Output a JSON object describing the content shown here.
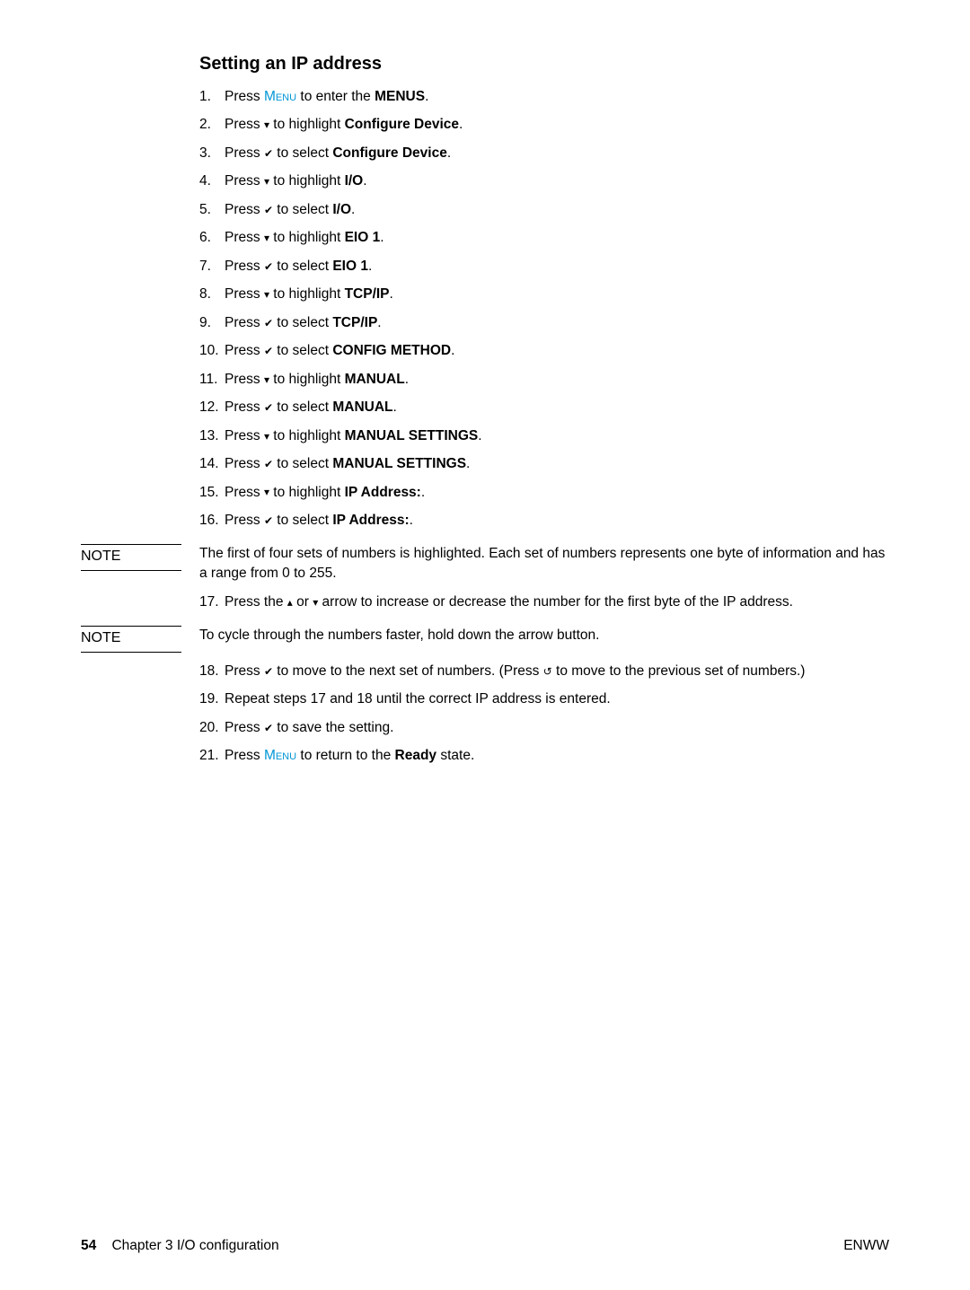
{
  "heading": "Setting an IP address",
  "menu_word": "Menu",
  "icons": {
    "down": "▾",
    "up": "▴",
    "check": "✔",
    "back": "↺"
  },
  "steps1": [
    {
      "n": "1.",
      "pre": "Press ",
      "menu": true,
      "mid": " to enter the ",
      "bold": "MENUS",
      "post": "."
    },
    {
      "n": "2.",
      "pre": "Press ",
      "icon": "down",
      "mid": " to highlight ",
      "bold": "Configure Device",
      "post": "."
    },
    {
      "n": "3.",
      "pre": "Press ",
      "icon": "check",
      "mid": " to select ",
      "bold": "Configure Device",
      "post": "."
    },
    {
      "n": "4.",
      "pre": "Press ",
      "icon": "down",
      "mid": " to highlight ",
      "bold": "I/O",
      "post": "."
    },
    {
      "n": "5.",
      "pre": "Press ",
      "icon": "check",
      "mid": " to select ",
      "bold": "I/O",
      "post": "."
    },
    {
      "n": "6.",
      "pre": "Press ",
      "icon": "down",
      "mid": " to highlight ",
      "bold": "EIO 1",
      "post": "."
    },
    {
      "n": "7.",
      "pre": "Press ",
      "icon": "check",
      "mid": " to select ",
      "bold": "EIO 1",
      "post": "."
    },
    {
      "n": "8.",
      "pre": "Press ",
      "icon": "down",
      "mid": " to highlight ",
      "bold": "TCP/IP",
      "post": "."
    },
    {
      "n": "9.",
      "pre": "Press ",
      "icon": "check",
      "mid": " to select ",
      "bold": "TCP/IP",
      "post": "."
    },
    {
      "n": "10.",
      "pre": "Press ",
      "icon": "check",
      "mid": " to select ",
      "bold": "CONFIG METHOD",
      "post": "."
    },
    {
      "n": "11.",
      "pre": "Press ",
      "icon": "down",
      "mid": " to highlight ",
      "bold": "MANUAL",
      "post": "."
    },
    {
      "n": "12.",
      "pre": "Press ",
      "icon": "check",
      "mid": " to select ",
      "bold": "MANUAL",
      "post": "."
    },
    {
      "n": "13.",
      "pre": "Press ",
      "icon": "down",
      "mid": " to highlight ",
      "bold": "MANUAL SETTINGS",
      "post": "."
    },
    {
      "n": "14.",
      "pre": "Press ",
      "icon": "check",
      "mid": " to select ",
      "bold": "MANUAL SETTINGS",
      "post": "."
    },
    {
      "n": "15.",
      "pre": "Press ",
      "icon": "down",
      "mid": " to highlight ",
      "bold": "IP Address:",
      "post": "."
    },
    {
      "n": "16.",
      "pre": "Press ",
      "icon": "check",
      "mid": " to select ",
      "bold": "IP Address:",
      "post": "."
    }
  ],
  "note1_label": "NOTE",
  "note1_body": "The first of four sets of numbers is highlighted. Each set of numbers represents one byte of information and has a range from 0 to 255.",
  "step17": {
    "n": "17.",
    "pre": "Press the ",
    "mid1": " or ",
    "mid2": " arrow to increase or decrease the number for the first byte of the IP address."
  },
  "note2_label": "NOTE",
  "note2_body": "To cycle through the numbers faster, hold down the arrow button.",
  "step18": {
    "n": "18.",
    "pre": "Press ",
    "mid1": " to move to the next set of numbers. (Press ",
    "mid2": " to move to the previous set of numbers.)"
  },
  "step19": {
    "n": "19.",
    "text": "Repeat steps 17 and 18 until the correct IP address is entered."
  },
  "step20": {
    "n": "20.",
    "pre": "Press ",
    "post": " to save the setting."
  },
  "step21": {
    "n": "21.",
    "pre": "Press ",
    "mid": " to return to the ",
    "bold": "Ready",
    "post": " state."
  },
  "footer": {
    "page": "54",
    "chapter": "Chapter 3   I/O configuration",
    "right": "ENWW"
  }
}
